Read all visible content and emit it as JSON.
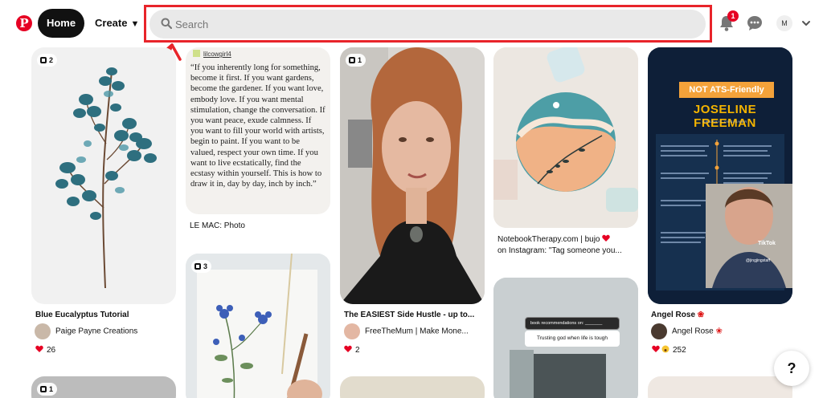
{
  "header": {
    "logo": "P",
    "home_label": "Home",
    "create_label": "Create",
    "search_placeholder": "Search",
    "notification_count": "1",
    "account_initial": "M"
  },
  "pins": {
    "eucalyptus": {
      "count": "2",
      "title": "Blue Eucalyptus Tutorial",
      "user": "Paige Payne Creations",
      "reactions": "26"
    },
    "quote": {
      "user": "lilcowgirl4",
      "text": "“If you inherently long for something, become it first. If you want gardens, become the gardener. If you want love, embody love. If you want mental stimulation, change the conversation. If you want peace, exude calmness. If you want to fill your world with artists, begin to paint. If you want to be valued, respect your own time. If you want to live ecstatically, find the ecstasy within yourself. This is how to draw it in, day by day, inch by inch.”",
      "title": "LE MAC: Photo"
    },
    "flowers": {
      "count": "3"
    },
    "video": {
      "count": "1",
      "title": "The EASIEST Side Hustle - up to...",
      "user": "FreeTheMum | Make Mone...",
      "reactions": "2"
    },
    "notebook": {
      "title_line1": "NotebookTherapy.com | bujo",
      "title_line2": "on Instagram: \"Tag someone you..."
    },
    "book": {
      "card1": "book recommendations on: _______",
      "card2": "Trusting god when life is tough"
    },
    "resume": {
      "tag": "NOT ATS-Friendly",
      "name": "JOSELINE FREEMAN",
      "role": "GRAPHIC DESIGNER",
      "tiktok": "TikTok",
      "tiktok_user": "@jingjingstaff",
      "title": "Angel Rose",
      "user": "Angel Rose",
      "reactions": "252"
    },
    "bottom_left": {
      "count": "1"
    }
  },
  "help_label": "?",
  "colors": {
    "brand": "#e60023",
    "highlight": "#e8242a",
    "resume_bg": "#142a4a",
    "resume_accent": "#f4a23a"
  }
}
